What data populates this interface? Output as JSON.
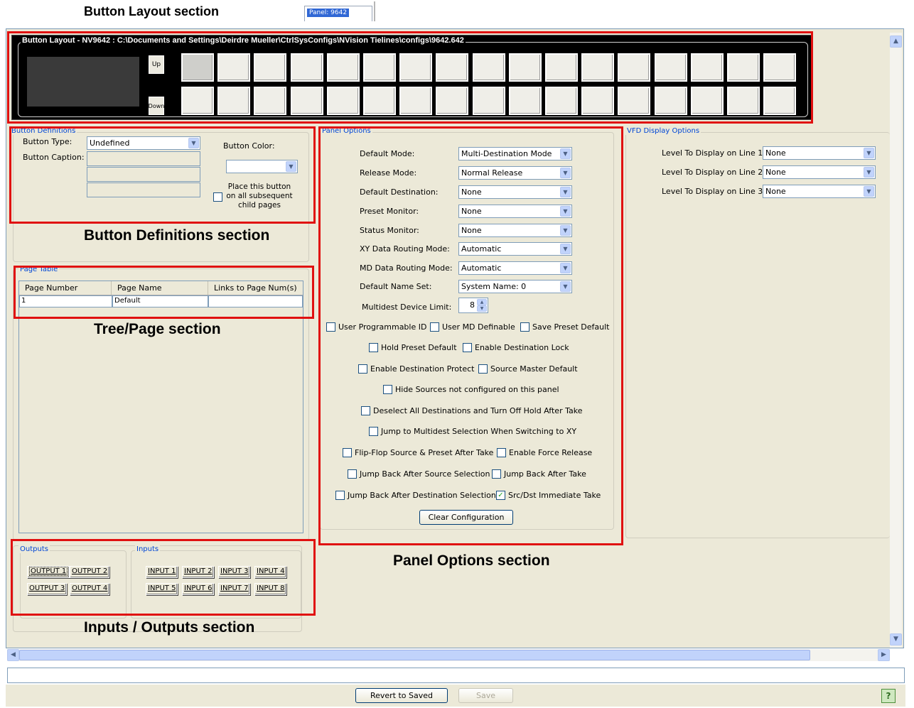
{
  "annotations": {
    "button_layout": "Button Layout section",
    "button_definitions": "Button Definitions section",
    "tree_page": "Tree/Page section",
    "inputs_outputs": "Inputs / Outputs section",
    "panel_options": "Panel Options section"
  },
  "tab": {
    "label": "Panel: 9642",
    "close": "×"
  },
  "button_layout": {
    "title": "Button Layout - NV9642 : C:\\Documents and Settings\\Deirdre Mueller\\CtrlSysConfigs\\NVision Tielines\\configs\\9642.642",
    "up_label": "Up",
    "down_label": "Down"
  },
  "button_definitions": {
    "group_label": "Button Definitions",
    "button_type_label": "Button Type:",
    "button_type_value": "Undefined",
    "button_caption_label": "Button Caption:",
    "button_color_label": "Button Color:",
    "button_color_value": "",
    "place_all_label": "Place this button on all subsequent child pages"
  },
  "page_table": {
    "group_label": "Page Table",
    "columns": [
      "Page Number",
      "Page Name",
      "Links to Page Num(s)"
    ],
    "rows": [
      [
        "1",
        "Default",
        ""
      ]
    ]
  },
  "outputs": {
    "label": "Outputs",
    "buttons": [
      "OUTPUT 1",
      "OUTPUT 2",
      "OUTPUT 3",
      "OUTPUT 4"
    ]
  },
  "inputs": {
    "label": "Inputs",
    "buttons": [
      "INPUT 1",
      "INPUT 2",
      "INPUT 3",
      "INPUT 4",
      "INPUT 5",
      "INPUT 6",
      "INPUT 7",
      "INPUT 8"
    ]
  },
  "panel_options": {
    "group_label": "Panel Options",
    "fields": [
      {
        "label": "Default Mode:",
        "value": "Multi-Destination Mode"
      },
      {
        "label": "Release Mode:",
        "value": "Normal Release"
      },
      {
        "label": "Default Destination:",
        "value": "None"
      },
      {
        "label": "Preset Monitor:",
        "value": "None"
      },
      {
        "label": "Status Monitor:",
        "value": "None"
      },
      {
        "label": "XY Data Routing Mode:",
        "value": "Automatic"
      },
      {
        "label": "MD Data Routing Mode:",
        "value": "Automatic"
      },
      {
        "label": "Default Name Set:",
        "value": "System Name: 0"
      }
    ],
    "device_limit_label": "Multidest Device Limit:",
    "device_limit_value": "8",
    "checkboxes": {
      "user_programmable_id": "User Programmable ID",
      "user_md_definable": "User MD Definable",
      "save_preset_default": "Save Preset Default",
      "hold_preset_default": "Hold Preset Default",
      "enable_destination_lock": "Enable Destination Lock",
      "enable_destination_protect": "Enable Destination Protect",
      "source_master_default": "Source Master Default",
      "hide_sources": "Hide Sources not configured on this panel",
      "deselect_all": "Deselect All Destinations and Turn Off Hold After Take",
      "jump_multidest": "Jump to Multidest Selection When Switching to XY",
      "flip_flop": "Flip-Flop Source & Preset After Take",
      "enable_force_release": "Enable Force Release",
      "jump_back_source": "Jump Back After Source Selection",
      "jump_back_take": "Jump Back After Take",
      "jump_back_destination": "Jump Back After Destination Selection",
      "src_dst_immediate": "Src/Dst Immediate Take"
    },
    "clear_label": "Clear Configuration"
  },
  "vfd": {
    "group_label": "VFD Display Options",
    "lines": [
      {
        "label": "Level To Display on Line 1:",
        "value": "None"
      },
      {
        "label": "Level To Display on Line 2:",
        "value": "None"
      },
      {
        "label": "Level To Display on Line 3:",
        "value": "None"
      }
    ]
  },
  "footer": {
    "revert_label": "Revert to Saved",
    "save_label": "Save",
    "help_icon": "?"
  }
}
